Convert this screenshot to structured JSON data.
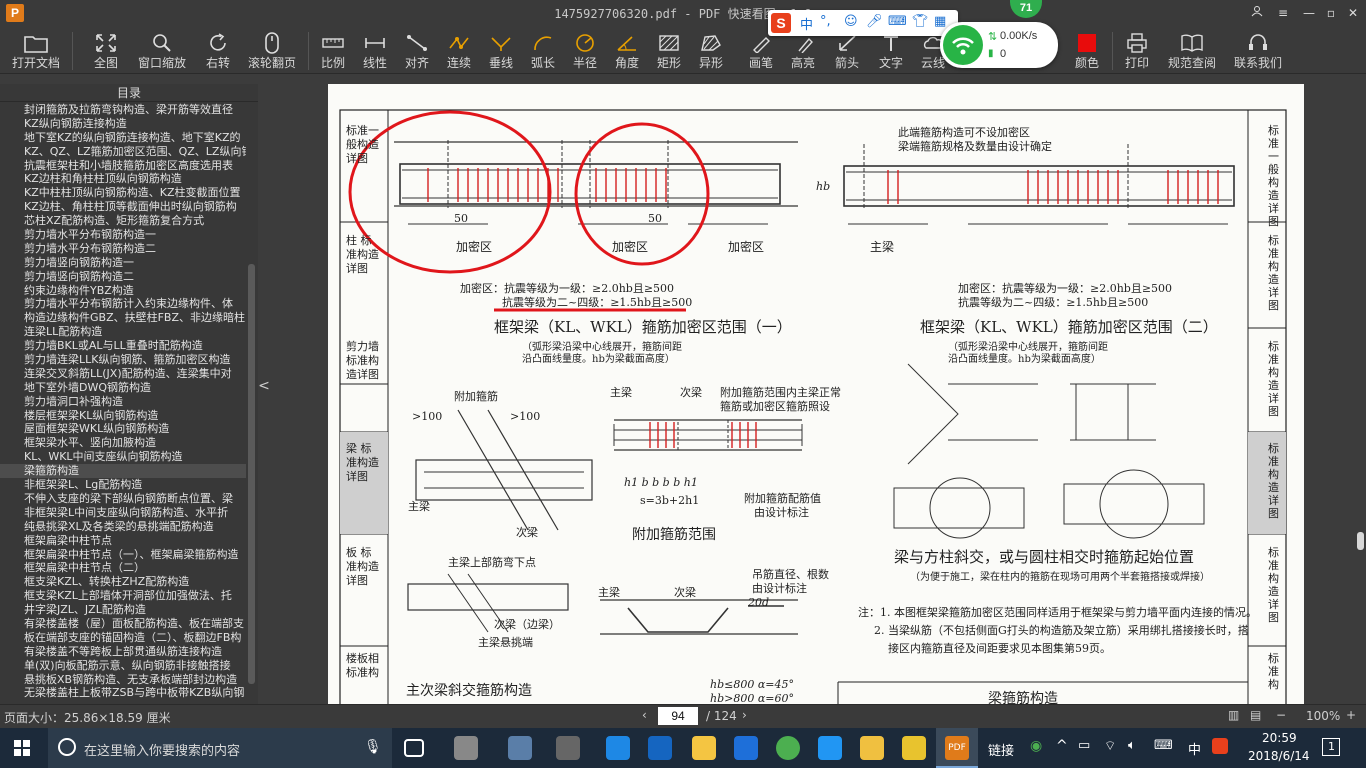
{
  "window": {
    "app_logo": "P",
    "title": "1475927706320.pdf - PDF 快速看图 v1.9",
    "controls": [
      "user-icon",
      "minimize-icon",
      "maximize-icon",
      "close-icon"
    ]
  },
  "toolbar": {
    "open": "打开文档",
    "fit": "全图",
    "window_zoom": "窗口缩放",
    "rotate": "右转",
    "scroll_page": "滚轮翻页",
    "scale": "比例",
    "linear": "线性",
    "aligned": "对齐",
    "continuous": "连续",
    "perpendicular": "垂线",
    "arc_length": "弧长",
    "radius": "半径",
    "angle": "角度",
    "rectangle": "矩形",
    "irregular": "异形",
    "pen": "画笔",
    "highlight": "高亮",
    "arrow": "箭头",
    "text": "文字",
    "cloud": "云线",
    "color": "颜色",
    "print": "打印",
    "standards": "规范查阅",
    "support": "联系我们"
  },
  "overlays": {
    "ime": {
      "logo": "S",
      "mode": "中",
      "punct": "°,",
      "items": [
        "emoji-icon",
        "mic-icon",
        "keyboard-icon",
        "skin-icon",
        "tools-icon"
      ]
    },
    "network": {
      "badge": "71",
      "speed": "0.00K/s",
      "count": "0"
    }
  },
  "sidebar": {
    "header": "目录",
    "collapse": "<",
    "items": [
      "封闭箍筋及拉筋弯钩构造、梁开筋等效直径",
      "KZ纵向钢筋连接构造",
      "地下室KZ的纵向钢筋连接构造、地下室KZ的",
      "KZ、QZ、LZ箍筋加密区范围、QZ、LZ纵向钢",
      "抗震框架柱和小墙肢箍筋加密区高度选用表",
      "KZ边柱和角柱柱顶纵向钢筋构造",
      "KZ中柱柱顶纵向钢筋构造、KZ柱变截面位置",
      "KZ边柱、角柱柱顶等截面伸出时纵向钢筋构",
      "芯柱XZ配筋构造、矩形箍筋复合方式",
      "剪力墙水平分布钢筋构造一",
      "剪力墙水平分布钢筋构造二",
      "剪力墙竖向钢筋构造一",
      "剪力墙竖向钢筋构造二",
      "约束边缘构件YBZ构造",
      "剪力墙水平分布钢筋计入约束边缘构件、体",
      "构造边缘构件GBZ、扶壁柱FBZ、非边缘暗柱",
      "连梁LL配筋构造",
      "剪力墙BKL或AL与LL重叠时配筋构造",
      "剪力墙连梁LLK纵向钢筋、箍筋加密区构造",
      "连梁交叉斜筋LL(JX)配筋构造、连梁集中对",
      "地下室外墙DWQ钢筋构造",
      "剪力墙洞口补强构造",
      "楼层框架梁KL纵向钢筋构造",
      "屋面框架梁WKL纵向钢筋构造",
      "框架梁水平、竖向加腋构造",
      "KL、WKL中间支座纵向钢筋构造",
      "梁箍筋构造",
      "非框架梁L、Lg配筋构造",
      "不伸入支座的梁下部纵向钢筋断点位置、梁",
      "非框架梁L中间支座纵向钢筋构造、水平折",
      "纯悬挑梁XL及各类梁的悬挑端配筋构造",
      "框架扁梁中柱节点",
      "框架扁梁中柱节点（一）、框架扁梁箍筋构造",
      "框架扁梁中柱节点（二）",
      "框支梁KZL、转换柱ZHZ配筋构造",
      "框支梁KZL上部墙体开洞部位加强做法、托",
      "井字梁JZL、JZL配筋构造",
      "有梁楼盖楼（屋）面板配筋构造、板在端部支",
      "板在端部支座的锚固构造（二）、板翻边FB构",
      "有梁楼盖不等跨板上部贯通纵筋连接构造",
      "单(双)向板配筋示意、纵向钢筋非接触搭接",
      "悬挑板XB钢筋构造、无支承板端部封边构造",
      "无梁楼盖柱上板带ZSB与跨中板带KZB纵向钢"
    ],
    "selected_index": 26
  },
  "document": {
    "side_tabs_left": [
      "标准一般构造详图",
      "柱 标准构造详图",
      "剪力墙 标准构造详图",
      "梁 标准构造详图",
      "板 标准构造详图",
      "楼板相 标准构"
    ],
    "side_tabs_right": [
      "标准一般构造详图",
      "标准构造详图",
      "标准构造详图",
      "标准构造详图",
      "标准构造详图",
      "标准构"
    ],
    "fig1": {
      "title": "框架梁（KL、WKL）箍筋加密区范围（一）",
      "note1": "（弧形梁沿梁中心线展开，箍筋间距",
      "note2": "沿凸面线量度。hb为梁截面高度）",
      "dense_line1": "加密区：抗震等级为一级：≥2.0hb且≥500",
      "dense_line2": "抗震等级为二~四级：≥1.5hb且≥500",
      "label_dense": "加密区",
      "label_50": "50",
      "label_hb": "hb"
    },
    "fig2": {
      "title": "框架梁（KL、WKL）箍筋加密区范围（二）",
      "note1": "（弧形梁沿梁中心线展开，箍筋间距",
      "note2": "沿凸面线量度。hb为梁截面高度）",
      "top_note1": "此端箍筋构造可不设加密区",
      "top_note2": "梁端箍筋规格及数量由设计确定",
      "dense_line1": "加密区：抗震等级为一级：≥2.0hb且≥500",
      "dense_line2": "抗震等级为二~四级：≥1.5hb且≥500",
      "label_main_beam": "主梁"
    },
    "fig3": {
      "title": "附加箍筋范围",
      "main_beam": "主梁",
      "sub_beam": "次梁",
      "note1": "附加箍筋范围内主梁正常",
      "note2": "箍筋或加密区箍筋照设",
      "note3": "附加箍筋配筋值",
      "note4": "由设计标注",
      "dim": "h1  b  b  b  b  h1",
      "s_label": "s=3b+2h1"
    },
    "fig4": {
      "title": "主次梁斜交箍筋构造",
      "extra": "附加箍筋",
      "gt100_a": ">100",
      "gt100_b": ">100",
      "main_beam": "主梁",
      "sub_beam": "次梁",
      "top_bend": "主梁上部筋弯下点",
      "edge_beam": "次梁（边梁）",
      "cantilever": "主梁悬挑端"
    },
    "fig5": {
      "title": "梁与方柱斜交，或与圆柱相交时箍筋起始位置",
      "note": "（为便于施工，梁在柱内的箍筋在现场可用两个半套箍搭接或焊接）"
    },
    "fig6": {
      "label1": "吊筋直径、根数",
      "label2": "由设计标注",
      "main_beam": "主梁",
      "sub_beam": "次梁",
      "d20": "20d",
      "hb800": "hb≤800  α=45°",
      "hb800b": "hb>800  α=60°"
    },
    "notes": {
      "n1": "注：1. 本图框架梁箍筋加密区范围同样适用于框架梁与剪力墙平面内连接的情况。",
      "n2": "2. 当梁纵筋（不包括侧面G打头的构造筋及架立筋）采用绑扎搭接接长时，搭",
      "n3": "接区内箍筋直径及间距要求见本图集第59页。"
    },
    "bottom_cut": "梁箍筋构造"
  },
  "status": {
    "page_size": "页面大小：25.86×18.59 厘米",
    "current_page": "94",
    "total_pages": "/ 124",
    "zoom": "100%"
  },
  "taskbar": {
    "search_placeholder": "在这里输入你要搜索的内容",
    "tray_label": "链接",
    "ime": "中",
    "time": "20:59",
    "date": "2018/6/14",
    "notifications": "1"
  },
  "colors": {
    "markup_red": "#e0161b",
    "rebar_red": "#d42020",
    "app_bg": "#3a3a3a",
    "taskbar_bg": "#1c2a3a"
  }
}
